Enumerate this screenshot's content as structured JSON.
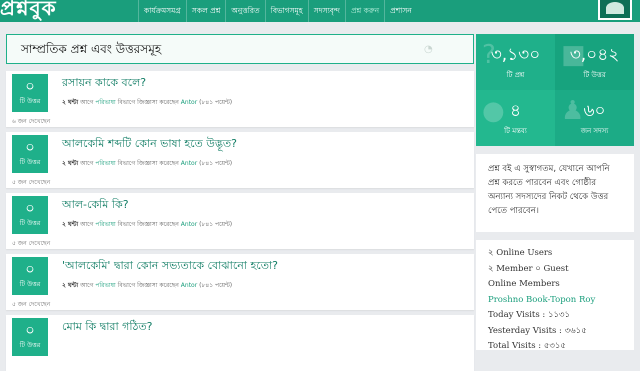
{
  "brand": {
    "logo_text": "প্রশ্নবুক"
  },
  "nav": {
    "items": [
      {
        "label": "কার্যক্রমসমগ্র"
      },
      {
        "label": "সকল প্রশ্ন"
      },
      {
        "label": "অনুত্তরিত"
      },
      {
        "label": "বিভাগসমূহ"
      },
      {
        "label": "সদস্যবৃন্দ"
      },
      {
        "label": "প্রশ্ন করুন"
      },
      {
        "label": "প্রশাসন"
      }
    ],
    "active_index": 5
  },
  "main": {
    "header_title": "সাম্প্রতিক প্রশ্ন এবং উত্তরসমূহ",
    "questions": [
      {
        "answers": "০",
        "answers_label": "টি উত্তর",
        "title": "রসায়ন কাকে বলে?",
        "time": "২ ঘন্টা",
        "prefix": "আগে",
        "category": "পরিভাষা",
        "mid": "বিভাগে জিজ্ঞাসা করেছেন",
        "user": "Antor",
        "points": "(৮৪১ পয়েন্ট)",
        "views": "৬ জন দেখেছেন"
      },
      {
        "answers": "০",
        "answers_label": "টি উত্তর",
        "title": "আলকেমি শব্দটি কোন ভাষা হতে উদ্ভূত?",
        "time": "২ ঘন্টা",
        "prefix": "আগে",
        "category": "পরিভাষা",
        "mid": "বিভাগে জিজ্ঞাসা করেছেন",
        "user": "Antor",
        "points": "(৮৪১ পয়েন্ট)",
        "views": "৫ জন দেখেছেন"
      },
      {
        "answers": "০",
        "answers_label": "টি উত্তর",
        "title": "আল-কেমি কি?",
        "time": "২ ঘন্টা",
        "prefix": "আগে",
        "category": "পরিভাষা",
        "mid": "বিভাগে জিজ্ঞাসা করেছেন",
        "user": "Antor",
        "points": "(৮৪১ পয়েন্ট)",
        "views": "৫ জন দেখেছেন"
      },
      {
        "answers": "০",
        "answers_label": "টি উত্তর",
        "title": "'আলকেমি' দ্বারা কোন সভ্যতাকে বোঝানো হতো?",
        "time": "২ ঘন্টা",
        "prefix": "আগে",
        "category": "পরিভাষা",
        "mid": "বিভাগে জিজ্ঞাসা করেছেন",
        "user": "Antor",
        "points": "(৮৪১ পয়েন্ট)",
        "views": "৫ জন দেখেছেন"
      },
      {
        "answers": "০",
        "answers_label": "টি উত্তর",
        "title": "মোম কি দ্বারা গঠিত?",
        "time": "",
        "prefix": "",
        "category": "",
        "mid": "",
        "user": "",
        "points": "",
        "views": ""
      }
    ]
  },
  "sidebar": {
    "stats": [
      {
        "value": "৩,১৩০",
        "label": "টি প্রশ্ন",
        "icon": "question-icon"
      },
      {
        "value": "৩,০৪২",
        "label": "টি উত্তর",
        "icon": "answer-icon"
      },
      {
        "value": "৪",
        "label": "টি মন্তব্য",
        "icon": "comment-icon"
      },
      {
        "value": "৬০",
        "label": "জন সদস্য",
        "icon": "users-icon"
      }
    ],
    "description": "প্রশ্ন বই এ সুস্বাগতম, যেখানে আপনি প্রশ্ন করতে পারবেন এবং গোষ্ঠীর অন্যান্য সদস্যদের নিকট থেকে উত্তর পেতে পারবেন।",
    "online": {
      "users_line": "২ Online Users",
      "members_guest_line": "২ Member ০ Guest",
      "online_members_label": "Online Members",
      "online_members_names": "Proshno Book-Topon Roy",
      "today_visits": "Today Visits : ১১৩১",
      "yesterday_visits": "Yesterday Visits : ৩৬১৫",
      "total_visits": "Total Visits : ৫৩১৫"
    }
  },
  "colors": {
    "brand": "#1a9e7c",
    "accent": "#1fb08a"
  }
}
